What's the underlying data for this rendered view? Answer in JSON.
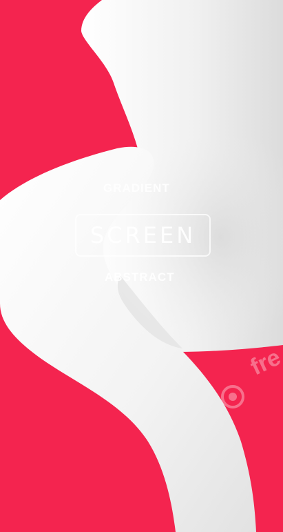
{
  "background": {
    "accent_color": "#f4244f",
    "ribbon_color": "#ffffff",
    "ribbon_shadow_color": "#d9d9d9"
  },
  "content": {
    "top_label": "GRADIENT",
    "main_label": "SCREEN",
    "bottom_label": "ABSTRACT"
  },
  "watermark": {
    "icon": "freepik-logo-icon",
    "text": "fre"
  }
}
